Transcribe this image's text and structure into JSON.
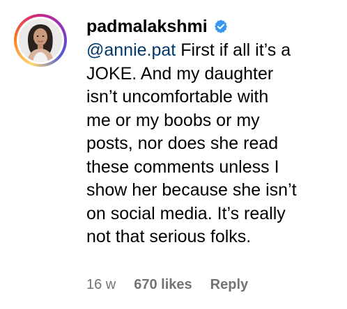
{
  "comment": {
    "username": "padmalakshmi",
    "verified_icon": "verified-badge-icon",
    "verified_color": "#3897f0",
    "mention": "@annie.pat",
    "lines": [
      " First if all it’s a",
      "JOKE. And my daughter",
      "isn’t uncomfortable with",
      "me or my boobs or my",
      "posts, nor does she read",
      "these comments unless I",
      "show her because she isn’t",
      "on social media. It’s really",
      "not that serious folks."
    ],
    "mention_color": "#00376b"
  },
  "footer": {
    "time": "16 w",
    "likes": "670 likes",
    "reply": "Reply",
    "text_color": "#737373"
  },
  "avatar": {
    "ring_colors": [
      "#feda75",
      "#fa7e1e",
      "#d62976",
      "#962fbf",
      "#4f5bd5"
    ]
  }
}
